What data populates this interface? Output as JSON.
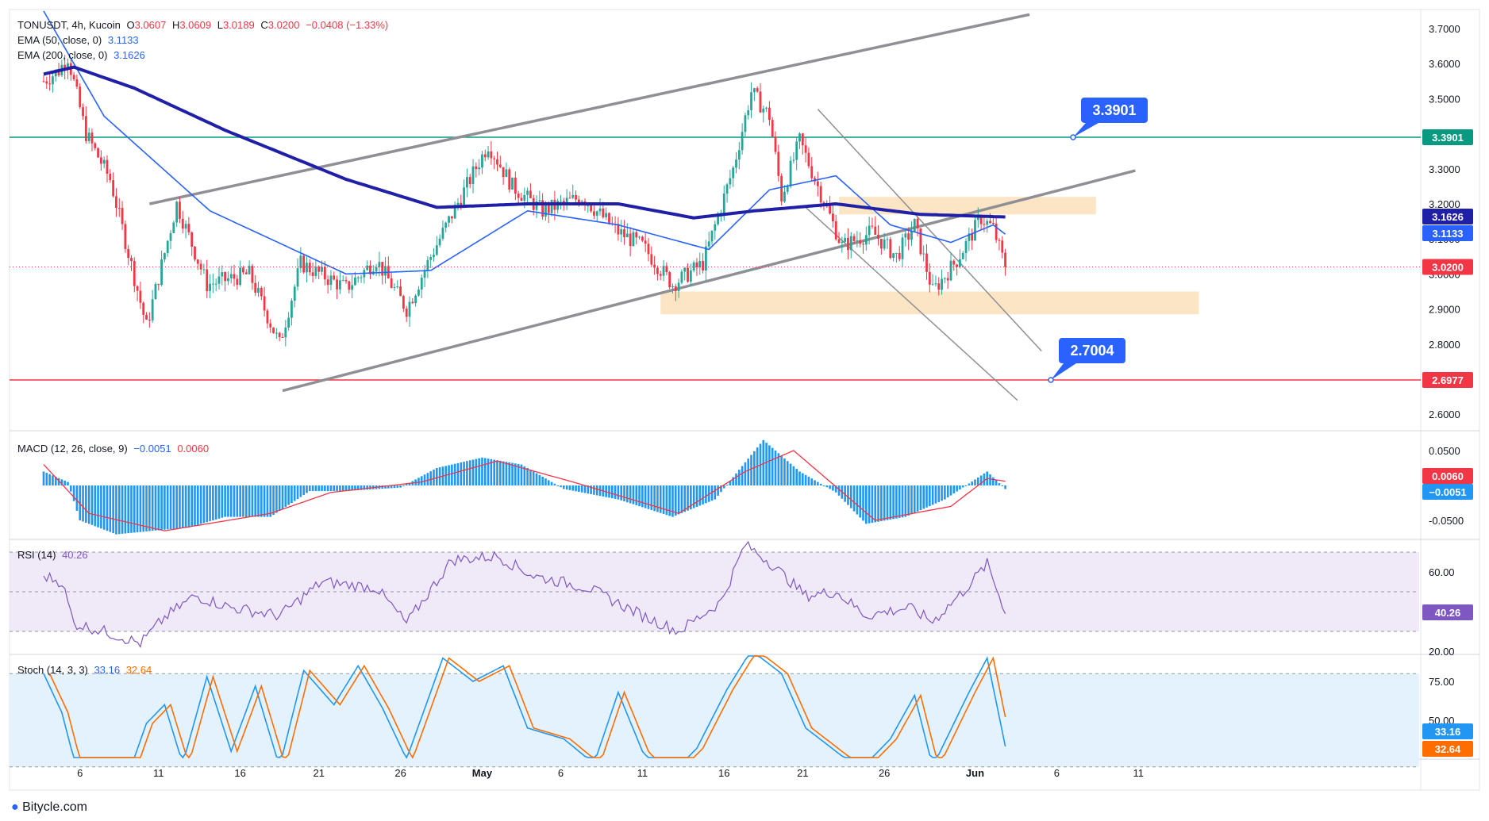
{
  "header": {
    "symbol": "TONUSDT, 4h, Kucoin",
    "o_label": "O",
    "o_value": "3.0607",
    "h_label": "H",
    "h_value": "3.0609",
    "l_label": "L",
    "l_value": "3.0189",
    "c_label": "C",
    "c_value": "3.0200",
    "change": "−0.0408 (−1.33%)",
    "ema50_label": "EMA (50, close, 0)",
    "ema50_value": "3.1133",
    "ema200_label": "EMA (200, close, 0)",
    "ema200_value": "3.1626"
  },
  "macd_legend": {
    "label": "MACD (12, 26, close, 9)",
    "macd": "−0.0051",
    "signal": "0.0060"
  },
  "rsi_legend": {
    "label": "RSI (14)",
    "value": "40.26"
  },
  "stoch_legend": {
    "label": "Stoch (14, 3, 3)",
    "k": "33.16",
    "d": "32.64"
  },
  "watermark": "Bitycle.com",
  "colors": {
    "up": "#26a69a",
    "down": "#f23645",
    "ema200": "#1f1fa8",
    "ema50": "#2962ff",
    "channel": "#8f8f95",
    "resistance": "#089981",
    "support": "#f23645",
    "zone": "#fbdcb0",
    "callout": "#2962ff",
    "macd_hist": "#2196f3",
    "signal": "#f23645",
    "rsi": "#7e57c2",
    "rsi_band": "#efe9f8",
    "stoch_k": "#2196f3",
    "stoch_d": "#ff6d00",
    "stoch_band": "#e3f2fd"
  },
  "chart_data": [
    {
      "type": "candlestick",
      "title": "TONUSDT, 4h, Kucoin",
      "x_ticks": [
        "6",
        "11",
        "16",
        "21",
        "26",
        "May",
        "6",
        "11",
        "16",
        "21",
        "26",
        "Jun",
        "6",
        "11"
      ],
      "y_ticks": [
        "3.7000",
        "3.6000",
        "3.5000",
        "3.4000",
        "3.3000",
        "3.2000",
        "3.1000",
        "3.0000",
        "2.9000",
        "2.8000",
        "2.7000",
        "2.6000"
      ],
      "ylim": [
        2.56,
        3.76
      ],
      "anchors": [
        {
          "t": 0,
          "p": 3.55
        },
        {
          "t": 5,
          "p": 3.58
        },
        {
          "t": 8,
          "p": 3.62
        },
        {
          "t": 14,
          "p": 3.4
        },
        {
          "t": 22,
          "p": 3.27
        },
        {
          "t": 34,
          "p": 2.85
        },
        {
          "t": 44,
          "p": 3.2
        },
        {
          "t": 54,
          "p": 2.97
        },
        {
          "t": 68,
          "p": 3.0
        },
        {
          "t": 78,
          "p": 2.8
        },
        {
          "t": 85,
          "p": 3.03
        },
        {
          "t": 100,
          "p": 2.96
        },
        {
          "t": 110,
          "p": 3.04
        },
        {
          "t": 120,
          "p": 2.9
        },
        {
          "t": 128,
          "p": 3.05
        },
        {
          "t": 138,
          "p": 3.22
        },
        {
          "t": 147,
          "p": 3.37
        },
        {
          "t": 155,
          "p": 3.25
        },
        {
          "t": 165,
          "p": 3.18
        },
        {
          "t": 178,
          "p": 3.22
        },
        {
          "t": 190,
          "p": 3.12
        },
        {
          "t": 198,
          "p": 3.08
        },
        {
          "t": 208,
          "p": 2.97
        },
        {
          "t": 218,
          "p": 3.03
        },
        {
          "t": 228,
          "p": 3.3
        },
        {
          "t": 234,
          "p": 3.52
        },
        {
          "t": 240,
          "p": 3.45
        },
        {
          "t": 244,
          "p": 3.22
        },
        {
          "t": 250,
          "p": 3.38
        },
        {
          "t": 256,
          "p": 3.25
        },
        {
          "t": 264,
          "p": 3.08
        },
        {
          "t": 274,
          "p": 3.12
        },
        {
          "t": 282,
          "p": 3.05
        },
        {
          "t": 288,
          "p": 3.14
        },
        {
          "t": 294,
          "p": 2.95
        },
        {
          "t": 302,
          "p": 3.04
        },
        {
          "t": 310,
          "p": 3.16
        },
        {
          "t": 314,
          "p": 3.13
        },
        {
          "t": 318,
          "p": 3.02
        }
      ],
      "ema50": [
        {
          "t": 0,
          "p": 3.75
        },
        {
          "t": 20,
          "p": 3.45
        },
        {
          "t": 55,
          "p": 3.18
        },
        {
          "t": 85,
          "p": 3.06
        },
        {
          "t": 100,
          "p": 3.0
        },
        {
          "t": 128,
          "p": 3.01
        },
        {
          "t": 160,
          "p": 3.18
        },
        {
          "t": 190,
          "p": 3.14
        },
        {
          "t": 220,
          "p": 3.07
        },
        {
          "t": 240,
          "p": 3.24
        },
        {
          "t": 262,
          "p": 3.28
        },
        {
          "t": 280,
          "p": 3.14
        },
        {
          "t": 300,
          "p": 3.09
        },
        {
          "t": 314,
          "p": 3.14
        },
        {
          "t": 318,
          "p": 3.1133
        }
      ],
      "ema200": [
        {
          "t": 0,
          "p": 3.57
        },
        {
          "t": 10,
          "p": 3.59
        },
        {
          "t": 30,
          "p": 3.53
        },
        {
          "t": 60,
          "p": 3.41
        },
        {
          "t": 100,
          "p": 3.27
        },
        {
          "t": 130,
          "p": 3.19
        },
        {
          "t": 160,
          "p": 3.2
        },
        {
          "t": 190,
          "p": 3.2
        },
        {
          "t": 215,
          "p": 3.16
        },
        {
          "t": 235,
          "p": 3.18
        },
        {
          "t": 262,
          "p": 3.2
        },
        {
          "t": 290,
          "p": 3.17
        },
        {
          "t": 318,
          "p": 3.1626
        }
      ],
      "horizontal_levels": [
        {
          "price": 3.3901,
          "label": "3.3901",
          "callout": "3.3901",
          "color": "resistance"
        },
        {
          "price": 2.6977,
          "label": "2.6977",
          "callout": "2.7004",
          "color": "support"
        }
      ],
      "zones": [
        {
          "t0": 263,
          "t1": 348,
          "top": 3.22,
          "bottom": 3.17
        },
        {
          "t0": 204,
          "t1": 382,
          "top": 2.95,
          "bottom": 2.885
        }
      ],
      "channel": [
        {
          "t0": 35,
          "p0": 3.2,
          "t1": 326,
          "p1": 3.74
        },
        {
          "t0": 79,
          "p0": 2.667,
          "t1": 361,
          "p1": 3.295
        }
      ],
      "descending_lines": [
        {
          "t0": 256,
          "p0": 3.47,
          "t1": 330,
          "p1": 2.78
        },
        {
          "t0": 252,
          "p0": 3.19,
          "t1": 322,
          "p1": 2.64
        }
      ],
      "right_labels": [
        {
          "value": "3.3901",
          "color": "resistance"
        },
        {
          "value": "3.1626",
          "color": "ema200"
        },
        {
          "value": "3.1133",
          "color": "ema50"
        },
        {
          "value": "3.0200",
          "color": "support"
        },
        {
          "value": "2.6977",
          "color": "support"
        }
      ]
    },
    {
      "type": "bar",
      "title": "MACD (12, 26, close, 9)",
      "y_ticks": [
        "0.0500",
        "-0.0500"
      ],
      "ylim": [
        -0.075,
        0.075
      ],
      "histogram_anchors": [
        {
          "t": 0,
          "v": 0.02
        },
        {
          "t": 8,
          "v": 0.005
        },
        {
          "t": 12,
          "v": -0.05
        },
        {
          "t": 24,
          "v": -0.07
        },
        {
          "t": 48,
          "v": -0.06
        },
        {
          "t": 60,
          "v": -0.045
        },
        {
          "t": 75,
          "v": -0.045
        },
        {
          "t": 88,
          "v": -0.008
        },
        {
          "t": 100,
          "v": -0.008
        },
        {
          "t": 118,
          "v": -0.003
        },
        {
          "t": 130,
          "v": 0.025
        },
        {
          "t": 145,
          "v": 0.04
        },
        {
          "t": 158,
          "v": 0.03
        },
        {
          "t": 172,
          "v": -0.005
        },
        {
          "t": 190,
          "v": -0.02
        },
        {
          "t": 208,
          "v": -0.045
        },
        {
          "t": 222,
          "v": -0.02
        },
        {
          "t": 238,
          "v": 0.065
        },
        {
          "t": 250,
          "v": 0.02
        },
        {
          "t": 262,
          "v": -0.01
        },
        {
          "t": 272,
          "v": -0.055
        },
        {
          "t": 285,
          "v": -0.045
        },
        {
          "t": 298,
          "v": -0.02
        },
        {
          "t": 312,
          "v": 0.02
        },
        {
          "t": 318,
          "v": -0.0051
        }
      ],
      "signal_anchors": [
        {
          "t": 0,
          "v": 0.03
        },
        {
          "t": 15,
          "v": -0.04
        },
        {
          "t": 40,
          "v": -0.065
        },
        {
          "t": 75,
          "v": -0.04
        },
        {
          "t": 95,
          "v": -0.01
        },
        {
          "t": 125,
          "v": 0.005
        },
        {
          "t": 150,
          "v": 0.035
        },
        {
          "t": 175,
          "v": 0.005
        },
        {
          "t": 210,
          "v": -0.04
        },
        {
          "t": 232,
          "v": 0.02
        },
        {
          "t": 248,
          "v": 0.05
        },
        {
          "t": 275,
          "v": -0.05
        },
        {
          "t": 300,
          "v": -0.03
        },
        {
          "t": 312,
          "v": 0.01
        },
        {
          "t": 318,
          "v": 0.006
        }
      ],
      "right_labels": [
        {
          "value": "0.0060",
          "color": "signal"
        },
        {
          "value": "−0.0051",
          "color": "macd_hist"
        }
      ]
    },
    {
      "type": "line",
      "title": "RSI (14)",
      "y_ticks": [
        "60.00",
        "20.00"
      ],
      "ylim": [
        20,
        80
      ],
      "band": [
        30,
        70
      ],
      "anchors": [
        {
          "t": 0,
          "v": 58
        },
        {
          "t": 6,
          "v": 55
        },
        {
          "t": 10,
          "v": 34
        },
        {
          "t": 20,
          "v": 30
        },
        {
          "t": 32,
          "v": 24
        },
        {
          "t": 40,
          "v": 37
        },
        {
          "t": 50,
          "v": 48
        },
        {
          "t": 62,
          "v": 42
        },
        {
          "t": 78,
          "v": 38
        },
        {
          "t": 92,
          "v": 55
        },
        {
          "t": 110,
          "v": 52
        },
        {
          "t": 120,
          "v": 34
        },
        {
          "t": 135,
          "v": 66
        },
        {
          "t": 150,
          "v": 68
        },
        {
          "t": 162,
          "v": 58
        },
        {
          "t": 180,
          "v": 52
        },
        {
          "t": 198,
          "v": 38
        },
        {
          "t": 210,
          "v": 30
        },
        {
          "t": 224,
          "v": 45
        },
        {
          "t": 232,
          "v": 74
        },
        {
          "t": 240,
          "v": 65
        },
        {
          "t": 252,
          "v": 48
        },
        {
          "t": 262,
          "v": 50
        },
        {
          "t": 272,
          "v": 38
        },
        {
          "t": 286,
          "v": 42
        },
        {
          "t": 294,
          "v": 35
        },
        {
          "t": 304,
          "v": 50
        },
        {
          "t": 312,
          "v": 64
        },
        {
          "t": 318,
          "v": 40.26
        }
      ],
      "right_labels": [
        {
          "value": "40.26",
          "color": "rsi"
        }
      ]
    },
    {
      "type": "line",
      "title": "Stoch (14, 3, 3)",
      "y_ticks": [
        "75.00",
        "50.00"
      ],
      "ylim": [
        18,
        100
      ],
      "band": [
        20,
        80
      ],
      "k_anchors": [
        {
          "t": 0,
          "v": 80
        },
        {
          "t": 6,
          "v": 55
        },
        {
          "t": 10,
          "v": 25
        },
        {
          "t": 22,
          "v": 12
        },
        {
          "t": 28,
          "v": 15
        },
        {
          "t": 34,
          "v": 48
        },
        {
          "t": 40,
          "v": 60
        },
        {
          "t": 46,
          "v": 22
        },
        {
          "t": 54,
          "v": 78
        },
        {
          "t": 62,
          "v": 30
        },
        {
          "t": 70,
          "v": 72
        },
        {
          "t": 78,
          "v": 20
        },
        {
          "t": 86,
          "v": 82
        },
        {
          "t": 96,
          "v": 60
        },
        {
          "t": 104,
          "v": 85
        },
        {
          "t": 112,
          "v": 58
        },
        {
          "t": 120,
          "v": 25
        },
        {
          "t": 132,
          "v": 90
        },
        {
          "t": 142,
          "v": 75
        },
        {
          "t": 152,
          "v": 85
        },
        {
          "t": 160,
          "v": 45
        },
        {
          "t": 172,
          "v": 38
        },
        {
          "t": 182,
          "v": 22
        },
        {
          "t": 190,
          "v": 68
        },
        {
          "t": 198,
          "v": 30
        },
        {
          "t": 206,
          "v": 12
        },
        {
          "t": 216,
          "v": 32
        },
        {
          "t": 226,
          "v": 70
        },
        {
          "t": 234,
          "v": 95
        },
        {
          "t": 244,
          "v": 80
        },
        {
          "t": 252,
          "v": 45
        },
        {
          "t": 262,
          "v": 30
        },
        {
          "t": 270,
          "v": 18
        },
        {
          "t": 280,
          "v": 38
        },
        {
          "t": 288,
          "v": 66
        },
        {
          "t": 294,
          "v": 20
        },
        {
          "t": 306,
          "v": 68
        },
        {
          "t": 312,
          "v": 90
        },
        {
          "t": 318,
          "v": 33.16
        }
      ],
      "d_offset": 2,
      "right_labels": [
        {
          "value": "33.16",
          "color": "stoch_k"
        },
        {
          "value": "32.64",
          "color": "stoch_d"
        }
      ]
    }
  ]
}
